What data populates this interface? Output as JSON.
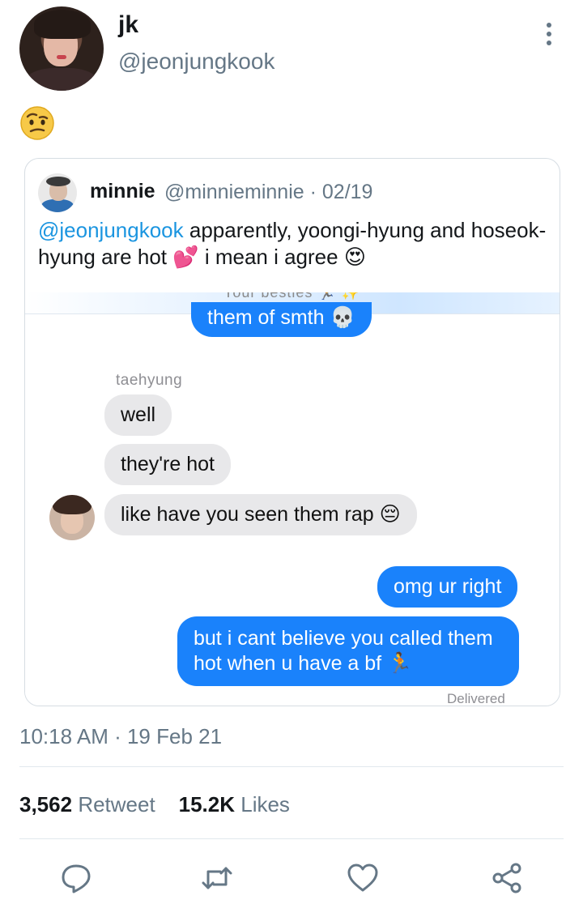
{
  "tweet": {
    "display_name": "jk",
    "handle": "@jeonjungkook",
    "body_emoji": "🤨",
    "timestamp": "10:18 AM · 19 Feb 21",
    "retweet_count": "3,562",
    "retweet_label": "Retweet",
    "like_count": "15.2K",
    "like_label": "Likes"
  },
  "quote": {
    "name": "minnie",
    "meta": "@minnieminnie · 02/19",
    "mention": "@jeonjungkook",
    "text_1": " apparently, yoongi-hyung and hoseok-hyung are hot ",
    "emoji_1": "💕",
    "text_2": " i mean i agree ",
    "emoji_2": "😍"
  },
  "chat": {
    "header_fragment": "Your besties 🏃 ✨",
    "msg_out_1": "them of smth 💀",
    "sender": "taehyung",
    "msg_in_1": "well",
    "msg_in_2": "they're hot",
    "msg_in_3": "like have you seen them rap 😔",
    "msg_out_2": "omg ur right",
    "msg_out_3_line1": "but i cant believe you called them",
    "msg_out_3_line2": "hot when u have a bf 🏃",
    "status": "Delivered"
  },
  "colors": {
    "accent": "#1b95e0",
    "imessage_blue": "#1a82fb",
    "imessage_gray": "#e8e8ea",
    "secondary_text": "#657786"
  },
  "icons": [
    "more-vertical-icon",
    "reply-icon",
    "retweet-icon",
    "like-icon",
    "share-icon"
  ]
}
